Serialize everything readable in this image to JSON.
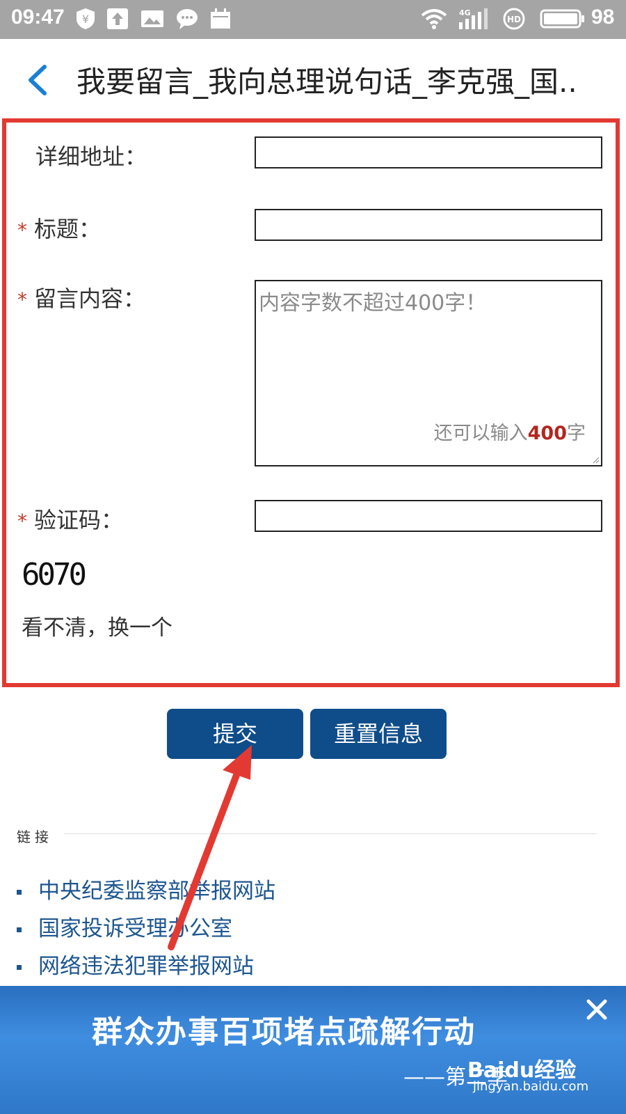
{
  "status_bar": {
    "time": "09:47",
    "battery": "98"
  },
  "header": {
    "title": "我要留言_我向总理说句话_李克强_国.."
  },
  "form": {
    "address_label": "详细地址：",
    "title_label": "标题：",
    "content_label": "留言内容：",
    "content_placeholder": "内容字数不超过400字！",
    "remaining_prefix": "还可以输入",
    "remaining_count": "400",
    "remaining_suffix": "字",
    "captcha_label": "验证码：",
    "captcha_image_text": "6070",
    "refresh_link": "看不清，换一个",
    "required_marker": "*"
  },
  "buttons": {
    "submit": "提交",
    "reset": "重置信息"
  },
  "links": {
    "heading": "链接",
    "items": [
      "中央纪委监察部举报网站",
      "国家投诉受理办公室",
      "网络违法犯罪举报网站"
    ]
  },
  "banner": {
    "text": "群众办事百项堵点疏解行动",
    "subtitle": "——第二季",
    "watermark_logo": "Baidu经验",
    "watermark_url": "jingyan.baidu.com"
  },
  "colors": {
    "accent": "#0f4d8a",
    "highlight_border": "#e23a32",
    "arrow": "#e23a32",
    "link": "#1d5690",
    "status_bar": "#a5a5a5"
  }
}
